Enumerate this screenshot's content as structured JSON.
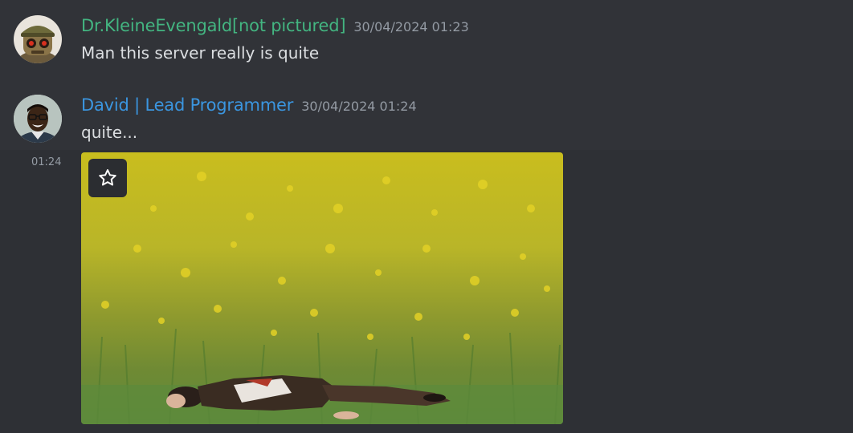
{
  "messages": [
    {
      "author": "Dr.KleineEvengald[not pictured]",
      "timestamp": "30/04/2024 01:23",
      "text": "Man this server really is quite",
      "author_color": "#43b581",
      "avatar_icon": "robot-avatar-icon"
    },
    {
      "author": "David | Lead Programmer",
      "timestamp": "30/04/2024 01:24",
      "text": "quite...",
      "author_color": "#3b96e0",
      "avatar_icon": "person-avatar-icon",
      "followup_time": "01:24",
      "attachment": {
        "type": "gif",
        "description_icon": "gif-attachment",
        "favorite_icon": "star-icon"
      }
    }
  ],
  "colors": {
    "background": "#313338",
    "text": "#dbdee1",
    "muted": "#949ba4"
  }
}
